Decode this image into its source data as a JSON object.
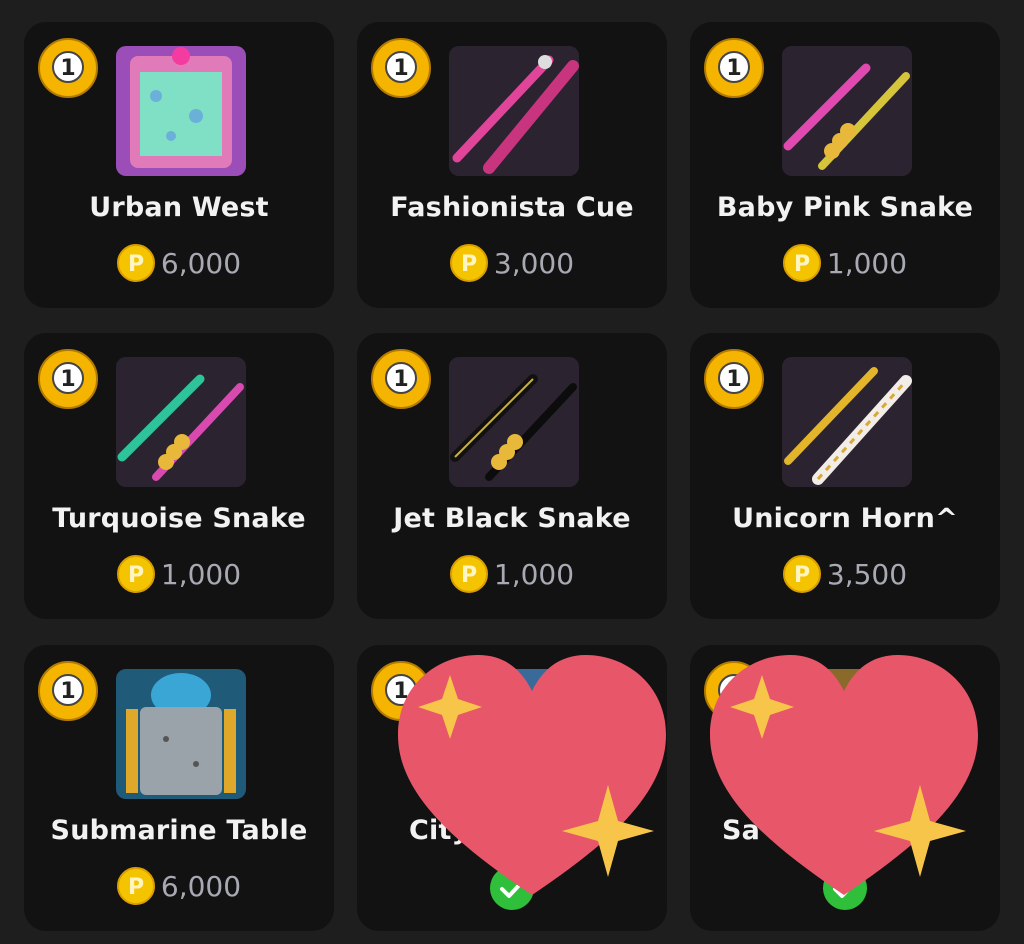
{
  "items": [
    {
      "name": "Urban West",
      "price": "6,000",
      "thumb": "table-urban-west"
    },
    {
      "name": "Fashionista Cue",
      "price": "3,000",
      "thumb": "cue-fashionista"
    },
    {
      "name": "Baby Pink Snake",
      "price": "1,000",
      "thumb": "cue-baby-pink-snake"
    },
    {
      "name": "Turquoise Snake",
      "price": "1,000",
      "thumb": "cue-turquoise-snake"
    },
    {
      "name": "Jet Black Snake",
      "price": "1,000",
      "thumb": "cue-jet-black-snake"
    },
    {
      "name": "Unicorn Horn^",
      "price": "3,500",
      "thumb": "cue-unicorn-horn"
    },
    {
      "name": "Submarine Table",
      "price": "6,000",
      "thumb": "table-submarine"
    },
    {
      "name": "City",
      "price": "",
      "thumb": "table-city",
      "owned": true
    },
    {
      "name": "Sa",
      "price": "",
      "thumb": "table-sa",
      "owned": true
    }
  ],
  "badge_number": "1",
  "colors": {
    "card_bg": "#121212",
    "page_bg": "#1e1e1e",
    "coin": "#f5c400",
    "heart": "#e8566a",
    "sparkle": "#f7c54a",
    "owned_check": "#2fbf3a"
  },
  "icons": {
    "badge": "pool-ball-1-icon",
    "currency": "pool-coin-icon",
    "owned": "check-circle-icon",
    "overlay": "sparkling-heart-emoji"
  }
}
